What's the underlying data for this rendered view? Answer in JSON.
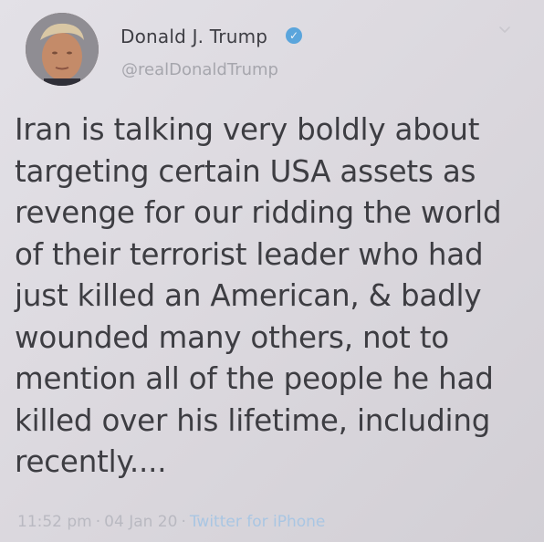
{
  "tweet": {
    "author": {
      "display_name": "Donald J. Trump",
      "handle": "@realDonaldTrump",
      "verified": true,
      "avatar_icon": "profile-photo"
    },
    "text": "Iran is talking very boldly about\ntargeting certain USA assets as\nrevenge for our ridding the world\nof their terrorist leader who had\njust killed an American, & badly\nwounded many others, not to\nmention all of the people he had\nkilled over his lifetime, including\nrecently....",
    "meta": {
      "time": "11:52 pm",
      "date": "04 Jan 20",
      "separator": "·",
      "source": "Twitter for iPhone"
    },
    "icons": {
      "verified": "verified-badge-icon",
      "menu": "chevron-down-icon"
    },
    "colors": {
      "verified_badge": "#5aa5dc",
      "source_link": "#a9c6e3",
      "text": "#3d3d42"
    }
  }
}
